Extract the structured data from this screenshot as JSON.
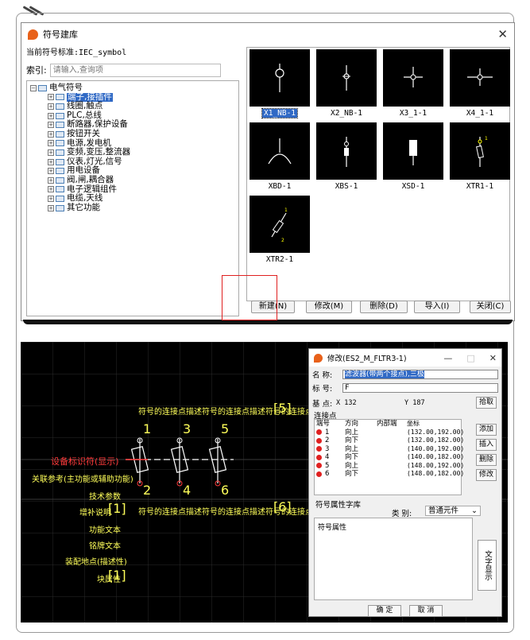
{
  "top_dialog": {
    "title": "符号建库",
    "close": "✕",
    "current_standard": "当前符号标准:IEC_symbol",
    "search_label": "索引:",
    "search_placeholder": "请输入,查询项",
    "tree_root": "电气符号",
    "tree_items": [
      "端子,接插件",
      "线圈,触点",
      "PLC,总线",
      "断路器,保护设备",
      "按钮开关",
      "电源,发电机",
      "变频,变压,整流器",
      "仪表,灯光,信号",
      "用电设备",
      "阀,闸,耦合器",
      "电子逻辑组件",
      "电缆,天线",
      "其它功能"
    ],
    "symbols": [
      "X1_NB-1",
      "X2_NB-1",
      "X3_1-1",
      "X4_1-1",
      "XBD-1",
      "XBS-1",
      "XSD-1",
      "XTR1-1",
      "XTR2-1"
    ],
    "buttons": {
      "new": "新建(N)",
      "modify": "修改(M)",
      "delete": "删除(D)",
      "import": "导入(I)",
      "close": "关闭(C)"
    }
  },
  "cad": {
    "top_desc": "符号的连接点描述符号的连接点描述符号的连接点描述",
    "bottom_desc": "符号的连接点描述符号的连接点描述符号的连接点描述",
    "bracket_top": "[5]",
    "bracket_bottom": "[6]",
    "device_tag": "设备标识符(显示)",
    "relation": "关联参考(主功能或辅助功能)",
    "tech_params": "技术参数",
    "supplement": "增补说明",
    "supplement_num": "[1]",
    "function_text": "功能文本",
    "nameplate": "铭牌文本",
    "install": "装配地点(描述性)",
    "block_structure": "块属性",
    "block_num": "[1]",
    "pin_top": [
      "1",
      "3",
      "5"
    ],
    "pin_bottom": [
      "2",
      "4",
      "6"
    ]
  },
  "edit_dialog": {
    "title": "修改(ES2_M_FLTR3-1)",
    "minimize": "—",
    "maximize": "□",
    "close": "✕",
    "name_label": "名 称:",
    "name_value": "滤波器(带两个接点),三极",
    "tag_label": "标 号:",
    "tag_value": "F",
    "base_label": "基 点:",
    "x_value": "X 132",
    "y_value": "Y 187",
    "pick_btn": "拾取",
    "conn_group": "连接点",
    "conn_headers": [
      "端号",
      "方向",
      "内部端",
      "坐标"
    ],
    "conn_rows": [
      {
        "num": "1",
        "dir": "向上",
        "coord": "(132.00,192.00)"
      },
      {
        "num": "2",
        "dir": "向下",
        "coord": "(132.00,182.00)"
      },
      {
        "num": "3",
        "dir": "向上",
        "coord": "(140.00,192.00)"
      },
      {
        "num": "4",
        "dir": "向下",
        "coord": "(140.00,182.00)"
      },
      {
        "num": "5",
        "dir": "向上",
        "coord": "(148.00,192.00)"
      },
      {
        "num": "6",
        "dir": "向下",
        "coord": "(148.00,182.00)"
      }
    ],
    "conn_buttons": [
      "添加",
      "插入",
      "删除",
      "修改"
    ],
    "attr_group": "符号属性字库",
    "category_label": "类 别:",
    "category_value": "普通元件",
    "attr_text": "符号属性",
    "text_display_btn": "文字显示",
    "ok": "确 定",
    "cancel": "取 消"
  }
}
